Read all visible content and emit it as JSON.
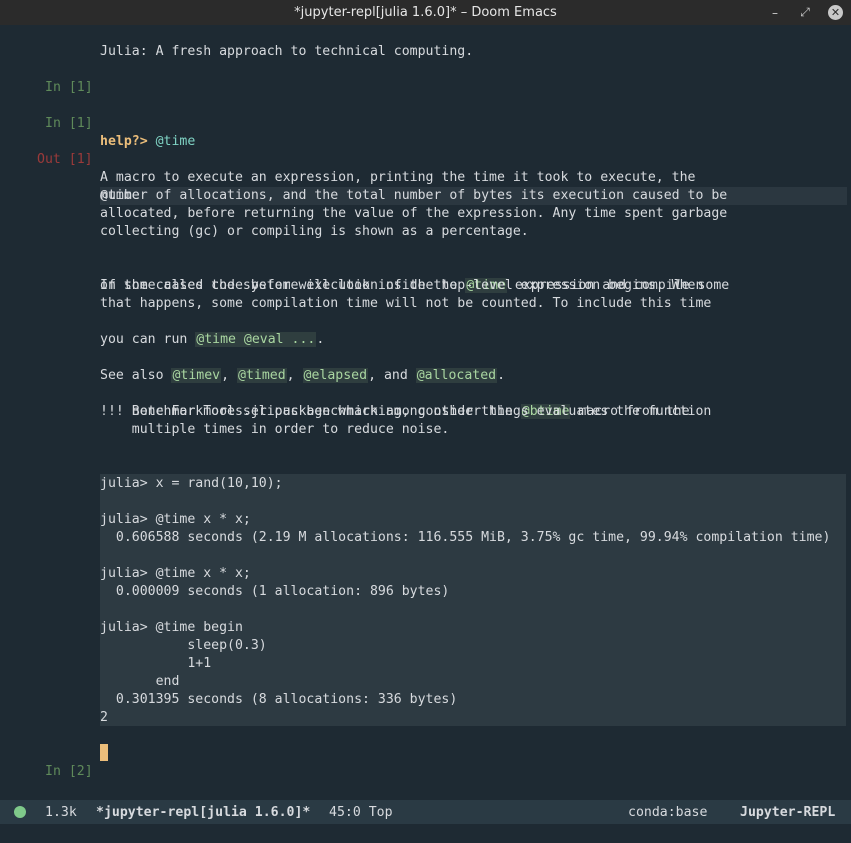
{
  "window": {
    "title": "*jupyter-repl[julia 1.6.0]* – Doom Emacs",
    "minimize": "–",
    "maximize": "⤢",
    "close": "✕"
  },
  "repl": {
    "banner": "Julia: A fresh approach to technical computing.",
    "in1a": "In [1]",
    "in1b": "In [1]",
    "help_prompt": "help?>",
    "help_query": "@time",
    "out1": "Out [1]",
    "out_head": "@time",
    "p1": [
      "A macro to execute an expression, printing the time it took to execute, the",
      "number of allocations, and the total number of bytes its execution caused to be",
      "allocated, before returning the value of the expression. Any time spent garbage",
      "collecting (gc) or compiling is shown as a percentage."
    ],
    "p2": {
      "l1a": "In some cases the system will look inside the ",
      "l1code": "@time",
      "l1b": " expression and compile some",
      "l2": "of the called code before execution of the top-level expression begins. When",
      "l3": "that happens, some compilation time will not be counted. To include this time",
      "l4a": "you can run ",
      "l4code": "@time @eval ...",
      "l4b": "."
    },
    "see_also": {
      "prefix": "See also ",
      "c1": "@timev",
      "s1": ", ",
      "c2": "@timed",
      "s2": ", ",
      "c3": "@elapsed",
      "s3": ", and ",
      "c4": "@allocated",
      "suffix": "."
    },
    "note": {
      "l1a": "!!! note For more serious benchmarking, consider the ",
      "l1code": "@btime",
      "l1b": " macro from the",
      "l2": "    BenchmarkTools.jl package which among other things evaluates the function",
      "l3": "    multiple times in order to reduce noise."
    },
    "code": [
      "julia> x = rand(10,10);",
      "",
      "julia> @time x * x;",
      "  0.606588 seconds (2.19 M allocations: 116.555 MiB, 3.75% gc time, 99.94% compilation time)",
      "",
      "julia> @time x * x;",
      "  0.000009 seconds (1 allocation: 896 bytes)",
      "",
      "julia> @time begin",
      "           sleep(0.3)",
      "           1+1",
      "       end",
      "  0.301395 seconds (8 allocations: 336 bytes)",
      "2"
    ],
    "in2": "In [2]"
  },
  "modeline": {
    "size": "1.3k",
    "buffer": "*jupyter-repl[julia 1.6.0]*",
    "position": "45:0 Top",
    "env": "conda:base",
    "mode": "Jupyter-REPL"
  }
}
